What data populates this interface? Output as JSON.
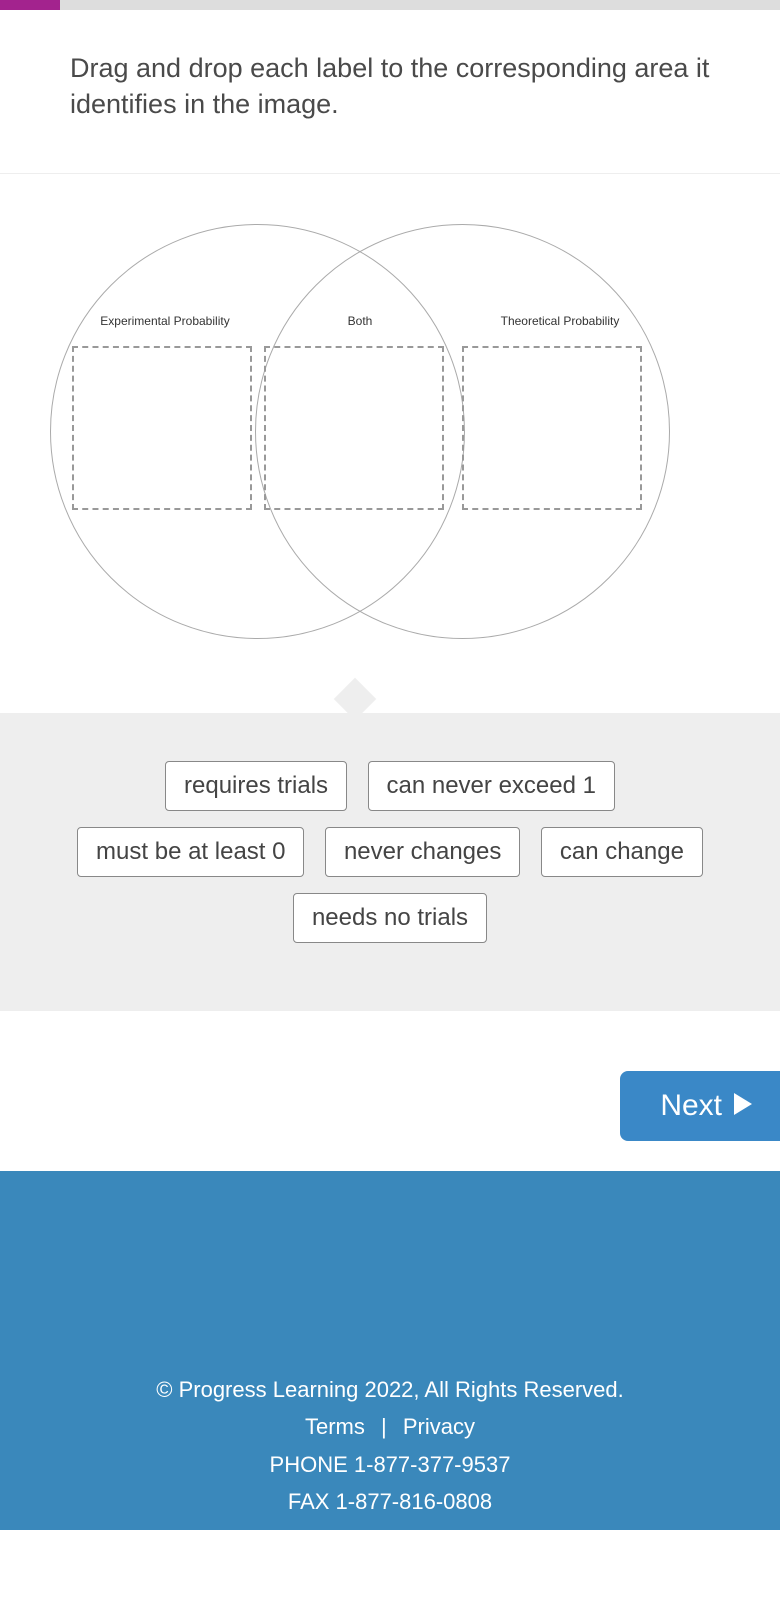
{
  "progress": {
    "percent": 8
  },
  "question": {
    "prompt": "Drag and drop each label to the corresponding area it identifies in the image."
  },
  "venn": {
    "left_label": "Experimental Probability",
    "center_label": "Both",
    "right_label": "Theoretical Probability"
  },
  "labels": [
    "requires trials",
    "can never exceed 1",
    "must be at least 0",
    "never changes",
    "can change",
    "needs no trials"
  ],
  "nav": {
    "next": "Next"
  },
  "footer": {
    "copyright": "© Progress Learning 2022, All Rights Reserved.",
    "terms": "Terms",
    "privacy": "Privacy",
    "phone": "PHONE 1-877-377-9537",
    "fax": "FAX 1-877-816-0808"
  }
}
